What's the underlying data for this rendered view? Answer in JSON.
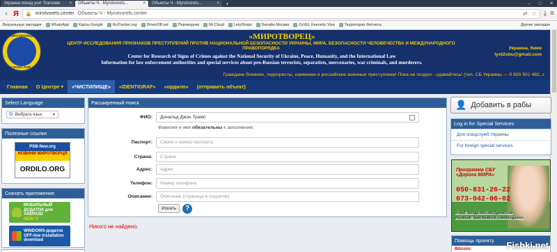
{
  "browser": {
    "tabs": [
      {
        "label": "Украина понад усе! Translate",
        "active": false
      },
      {
        "label": "Объекты Ч - Myrotvorets...",
        "active": true
      },
      {
        "label": "Объекты Ч - Myrotvorets...",
        "active": false
      }
    ],
    "new_tab": "+",
    "logo": "Я",
    "url": "mirotvorets.center",
    "page_title": "Объекты Ч - Myrotvorets.center",
    "bookmarks": [
      "Визуальные закладки",
      "WhatsApp",
      "Карты Google",
      "RuTracker.org",
      "DriverOff.net",
      "Переводчик",
      "Mi Cloud",
      "LetyShops",
      "Билайн Москва",
      "ZyXEL Keenetic Viva",
      "Территория Фитнеса"
    ],
    "other_bookmarks": "Другие закладки"
  },
  "header": {
    "logo_top": "МИРОТВОРЕЦЬ",
    "logo_bottom": "PRO BONO PUBLICO",
    "title": "«МИРОТВОРЕЦ»",
    "subtitle": "ЦЕНТР ИССЛЕДОВАНИЯ ПРИЗНАКОВ ПРЕСТУПЛЕНИЙ ПРОТИВ НАЦИОНАЛЬНОЙ БЕЗОПАСНОСТИ УКРАИНЫ, МИРА, БЕЗОПАСНОСТИ ЧЕЛОВЕЧЕСТВА И МЕЖДУНАРОДНОГО ПРАВОПОРЯДКА",
    "english1": "Center for Research of Signs of Crimes against the National Security of Ukraine, Peace, Humanity, and the International Law",
    "english2": "Information for law enforcement authorities and special services about pro-Russian terrorists, separatists, mercenaries, war criminals, and murderers.",
    "location": "Украина, Киев",
    "email": "lyst2sbu@gmail.com",
    "ticker": "Граждане боевики, террористы, наемники и российские военные преступники! Пока не поздно - сдавайтесь! (тел. СБ Украины — 0 800 501 482, с"
  },
  "nav": {
    "items": [
      "Главная",
      "О Центре ▾",
      "«ЧИСТИЛИЩЕ»",
      "«IDENTIGRAF»",
      "«ордило»",
      "(отправить объект)"
    ]
  },
  "sidebar": {
    "lang_title": "Select Language",
    "lang_select": "Выбрать язык",
    "links_title": "Полезные ссылки",
    "banner_top": "PSB-New.org",
    "banner_mid": "НОВИНИ МИРОТВОРЦЯ",
    "banner_bot": "ORDILO.ORG",
    "apps_title": "Скачать приложения",
    "android_label": "МОБИЛЬНЫЙ ДОДАТОК для ANDROID",
    "android_tag": "NEW !!!",
    "windows_label": "WINDOWS-додаток OFF-line installation download"
  },
  "search": {
    "title": "Расширенный поиск",
    "fio_label": "ФИО:",
    "fio_value": "Дональд  Джон Трамп",
    "fio_hint_pre": "Фамилия и имя ",
    "fio_hint_bold": "обязательны",
    "fio_hint_post": " к заполнению",
    "passport_label": "Паспорт:",
    "passport_ph": "Серия и номер паспорта",
    "country_label": "Страна:",
    "country_ph": "Страна",
    "address_label": "Адрес:",
    "address_ph": "Адрес",
    "phone_label": "Телефон:",
    "phone_ph": "Номер телефона",
    "desc_label": "Описание:",
    "desc_ph": "Описание (страница в соцсетях)",
    "search_btn": "Искать",
    "help": "?",
    "not_found": "Никого не найдено."
  },
  "right": {
    "add_btn": "Добавить в рабы",
    "login_title": "Log in for Special Services",
    "login_items": [
      "Для спецслужб Украины",
      "For foreign special services"
    ],
    "ad_t1": "Программа СБУ",
    "ad_t2": "«Дорога МИРА»",
    "ad_phone1": "050-831-26-22",
    "ad_phone2": "073-042-06-02",
    "ad_email": "e-mail: doroga.mira.sbu@gmail.com",
    "ad_fb": "Facebook: www.facebook.com/dorogamira",
    "help_title": "Помощь проекту",
    "bitcoin": "Bitcoin:"
  },
  "watermark": "Fishki.net"
}
